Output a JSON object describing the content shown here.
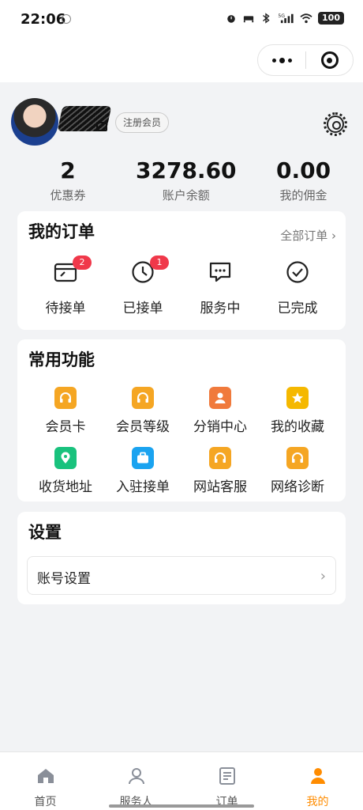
{
  "status_bar": {
    "time": "22:06",
    "network": "5G",
    "battery": "100"
  },
  "profile": {
    "member_badge": "注册会员",
    "stats": [
      {
        "value": "2",
        "label": "优惠券"
      },
      {
        "value": "3278.60",
        "label": "账户余额"
      },
      {
        "value": "0.00",
        "label": "我的佣金"
      }
    ]
  },
  "orders": {
    "title": "我的订单",
    "all_link": "全部订单 ›",
    "items": [
      {
        "label": "待接单",
        "badge": "2",
        "icon": "pending-order-icon"
      },
      {
        "label": "已接单",
        "badge": "1",
        "icon": "clock-icon"
      },
      {
        "label": "服务中",
        "icon": "chat-icon"
      },
      {
        "label": "已完成",
        "icon": "check-circle-icon"
      }
    ]
  },
  "functions": {
    "title": "常用功能",
    "items": [
      {
        "label": "会员卡",
        "icon": "headset-icon",
        "color": "#f5a623"
      },
      {
        "label": "会员等级",
        "icon": "headset-icon",
        "color": "#f5a623"
      },
      {
        "label": "分销中心",
        "icon": "person-icon",
        "color": "#f07a3c"
      },
      {
        "label": "我的收藏",
        "icon": "star-icon",
        "color": "#f5b800"
      },
      {
        "label": "收货地址",
        "icon": "location-icon",
        "color": "#19c27d"
      },
      {
        "label": "入驻接单",
        "icon": "briefcase-icon",
        "color": "#1aa3f0"
      },
      {
        "label": "网站客服",
        "icon": "headset-icon",
        "color": "#f5a623"
      },
      {
        "label": "网络诊断",
        "icon": "headset-icon",
        "color": "#f5a623"
      }
    ]
  },
  "settings": {
    "title": "设置",
    "account_label": "账号设置",
    "chevron": "›"
  },
  "tabbar": {
    "items": [
      {
        "label": "首页",
        "icon": "home-icon"
      },
      {
        "label": "服务人",
        "icon": "user-outline-icon"
      },
      {
        "label": "订单",
        "icon": "document-icon"
      },
      {
        "label": "我的",
        "icon": "user-filled-icon",
        "active": true
      }
    ],
    "active_color": "#ff8c00"
  }
}
